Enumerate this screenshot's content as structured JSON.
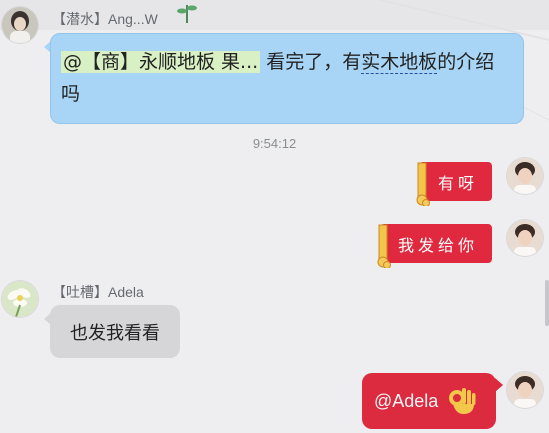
{
  "messages": {
    "first": {
      "sender": "【潜水】Ang...W",
      "mention": "@【商】永顺地板 果...",
      "text_a": " 看完了，有",
      "text_underlined": "实木地板",
      "text_b": "的介绍",
      "text_c": "吗"
    },
    "time": "9:54:12",
    "reply1": "有呀",
    "reply2": "我发给你",
    "adela": {
      "sender": "【吐槽】Adela",
      "text": "也发我看看"
    },
    "last": {
      "text": "@Adela",
      "emoji": "ok-hand-emoji"
    }
  },
  "colors": {
    "blue_bubble": "#a8d5f6",
    "red_card": "#e0293e",
    "gray_bubble": "#d6d6d9"
  }
}
